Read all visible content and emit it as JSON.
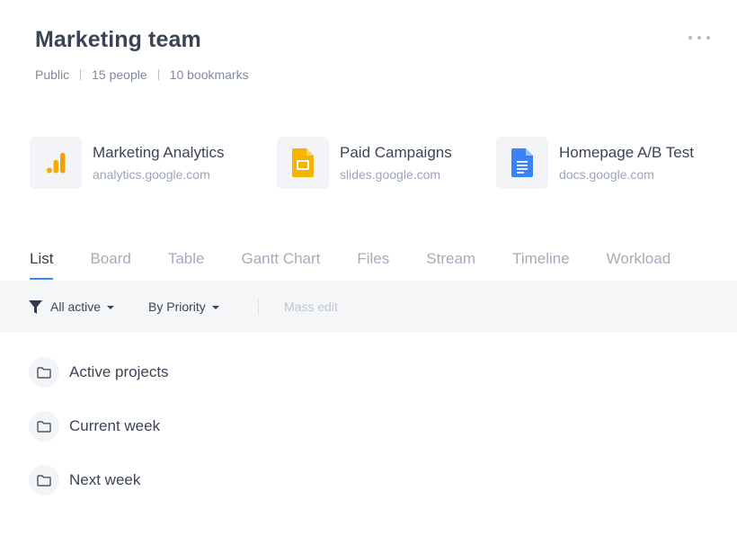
{
  "header": {
    "title": "Marketing team",
    "meta": [
      "Public",
      "15 people",
      "10 bookmarks"
    ]
  },
  "bookmarks": [
    {
      "name": "Marketing Analytics",
      "url": "analytics.google.com",
      "icon": "google-analytics-icon",
      "color": "#f9ab00"
    },
    {
      "name": "Paid Campaigns",
      "url": "slides.google.com",
      "icon": "google-slides-icon",
      "color": "#f5b400"
    },
    {
      "name": "Homepage A/B Test",
      "url": "docs.google.com",
      "icon": "google-docs-icon",
      "color": "#3b82f6"
    }
  ],
  "tabs": [
    {
      "label": "List",
      "active": true
    },
    {
      "label": "Board"
    },
    {
      "label": "Table"
    },
    {
      "label": "Gantt Chart"
    },
    {
      "label": "Files"
    },
    {
      "label": "Stream"
    },
    {
      "label": "Timeline"
    },
    {
      "label": "Workload"
    }
  ],
  "toolbar": {
    "filter_label": "All active",
    "sort_label": "By Priority",
    "mass_edit_label": "Mass edit",
    "filter_icon": "filter-icon"
  },
  "list": [
    {
      "label": "Active projects",
      "icon": "folder-icon"
    },
    {
      "label": "Current week",
      "icon": "folder-icon"
    },
    {
      "label": "Next week",
      "icon": "folder-icon"
    }
  ],
  "colors": {
    "accent": "#2f8cf2",
    "toolbar_bg": "#f5f6f8"
  }
}
